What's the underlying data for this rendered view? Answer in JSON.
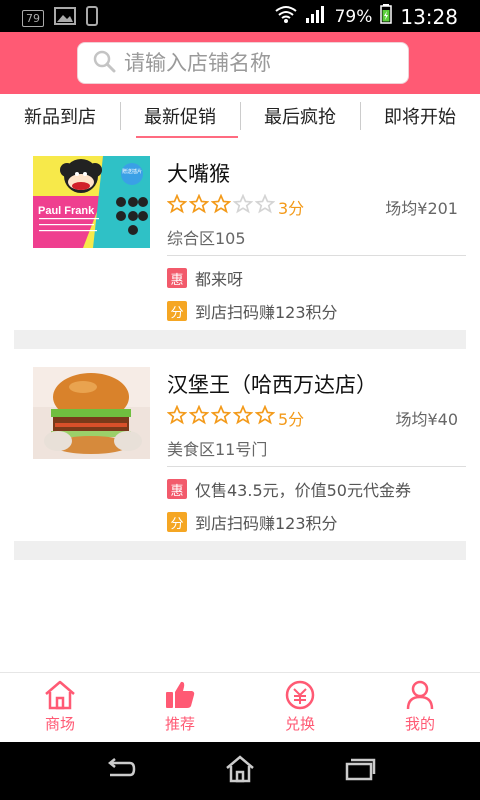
{
  "statusbar": {
    "notification_count": "79",
    "battery": "79%",
    "time": "13:28"
  },
  "search": {
    "placeholder": "请输入店铺名称",
    "value": ""
  },
  "tabs": [
    {
      "label": "新品到店",
      "active": false
    },
    {
      "label": "最新促销",
      "active": true
    },
    {
      "label": "最后疯抢",
      "active": false
    },
    {
      "label": "即将开始",
      "active": false
    }
  ],
  "stores": [
    {
      "name": "大嘴猴",
      "rating": 3,
      "score": "3分",
      "avg_price": "场均¥201",
      "area": "综合区105",
      "thumb_icon": "paul-frank-logo",
      "thumb_text": {
        "brand": "Paul Frank",
        "badge": "赠送插片"
      },
      "promos": [
        {
          "tag": "惠",
          "text": "都来呀"
        },
        {
          "tag": "分",
          "text": "到店扫码赚123积分"
        }
      ]
    },
    {
      "name": "汉堡王（哈西万达店）",
      "rating": 5,
      "score": "5分",
      "avg_price": "场均¥40",
      "area": "美食区11号门",
      "thumb_icon": "burger-photo",
      "promos": [
        {
          "tag": "惠",
          "text": "仅售43.5元，价值50元代金券"
        },
        {
          "tag": "分",
          "text": "到店扫码赚123积分"
        }
      ]
    }
  ],
  "bottom_nav": [
    {
      "label": "商场",
      "icon": "home-icon"
    },
    {
      "label": "推荐",
      "icon": "thumbs-up-icon"
    },
    {
      "label": "兑换",
      "icon": "exchange-icon"
    },
    {
      "label": "我的",
      "icon": "user-icon"
    }
  ],
  "colors": {
    "brand": "#ff5a74",
    "star": "#f39a1a",
    "tag_hui": "#f25a6b",
    "tag_fen": "#f5a623"
  }
}
